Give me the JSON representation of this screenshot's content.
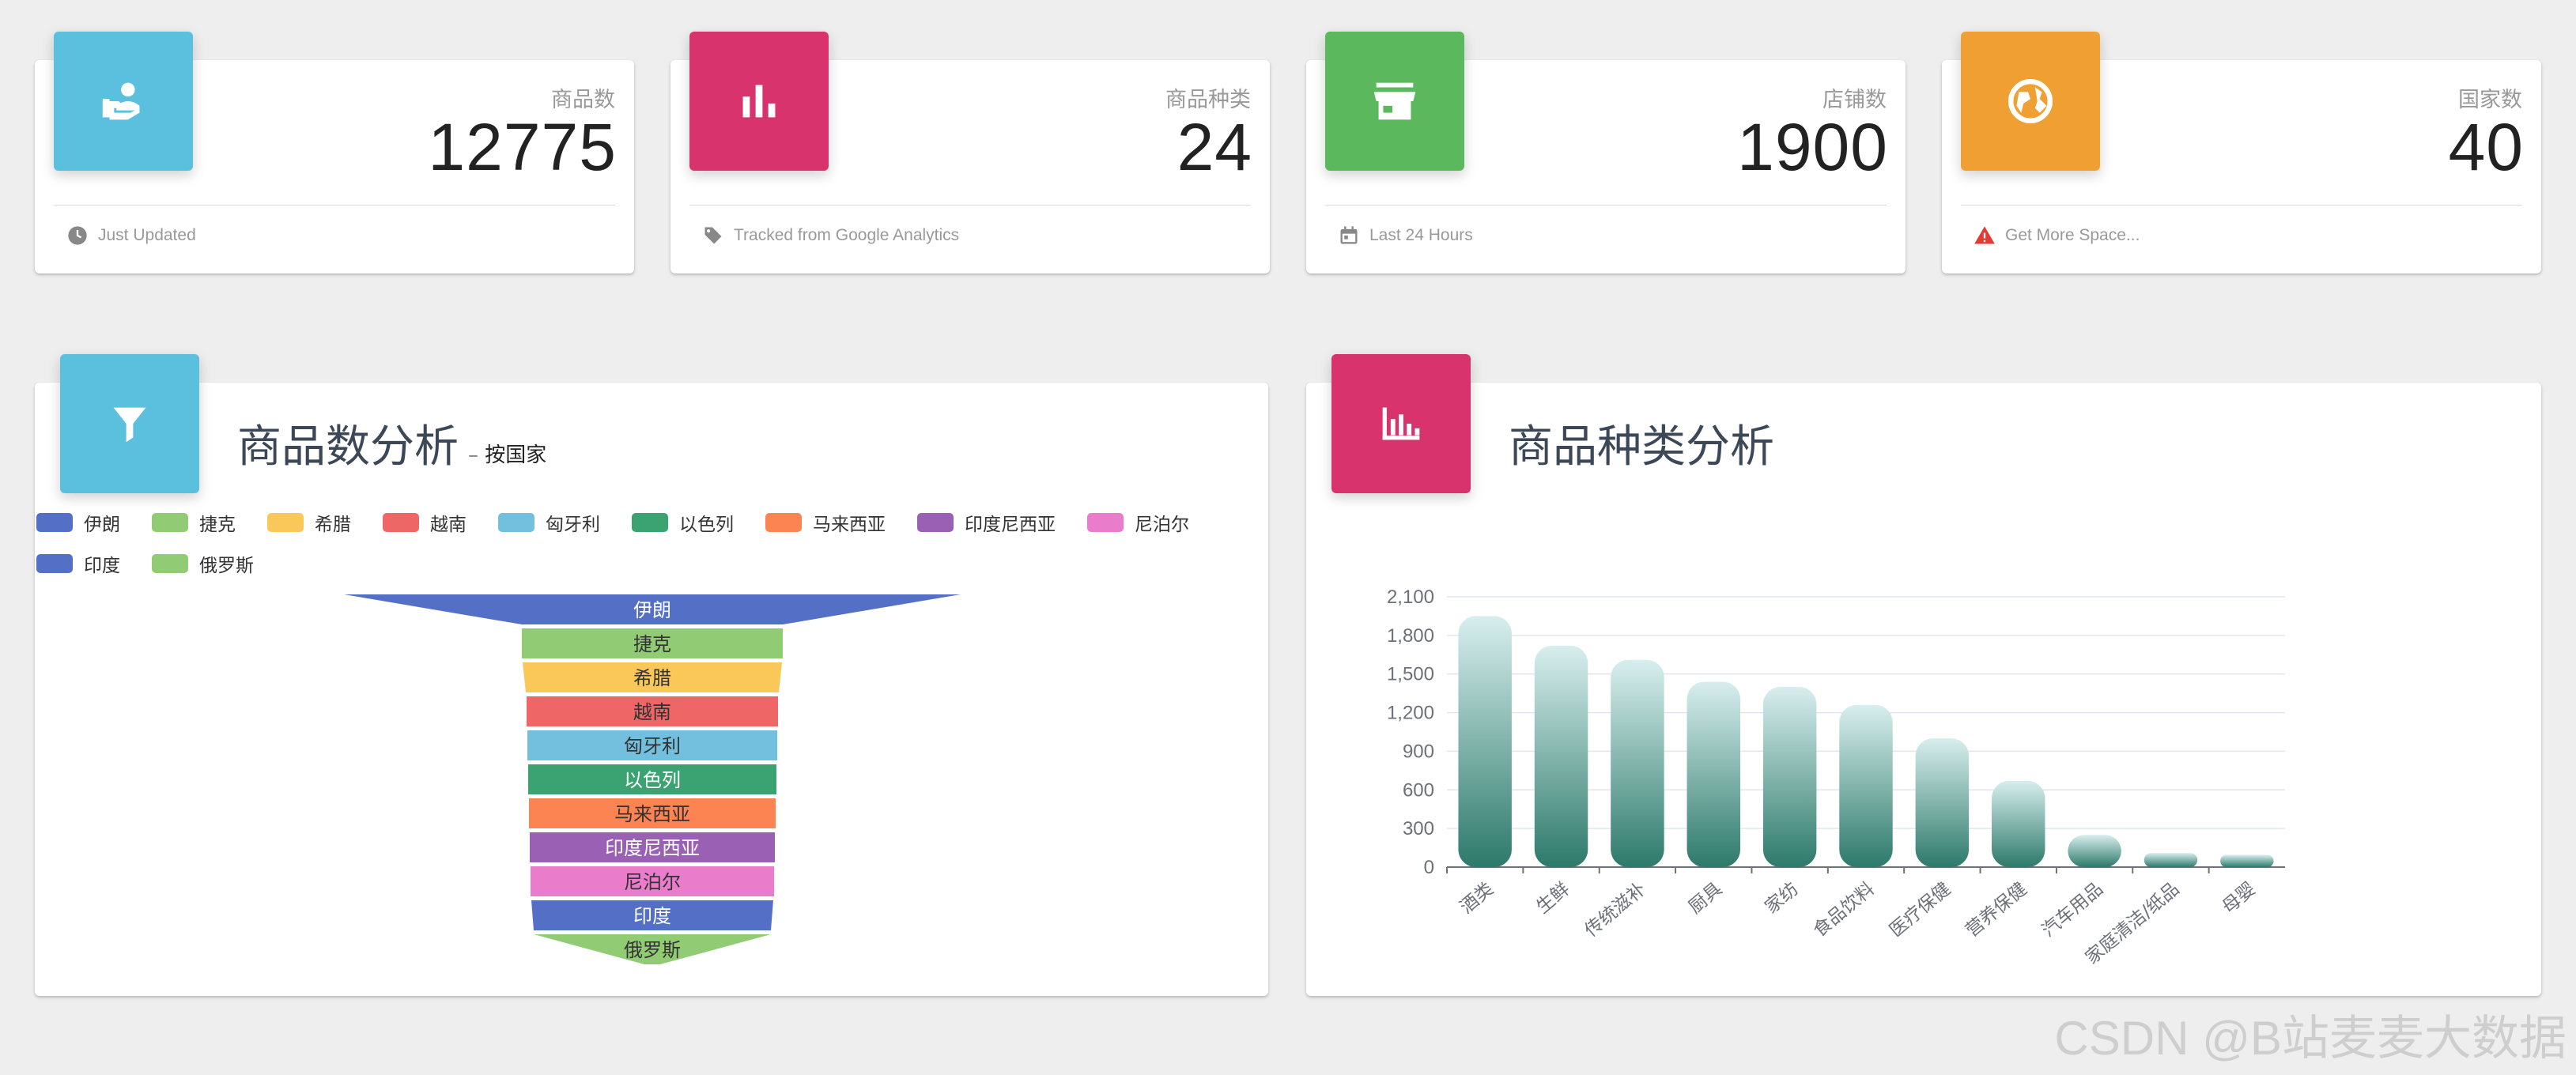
{
  "stats": [
    {
      "label": "商品数",
      "value": "12775",
      "footer": "Just Updated",
      "icon": "user-hand-icon",
      "footer_icon": "clock-icon",
      "color": "#5bc0de"
    },
    {
      "label": "商品种类",
      "value": "24",
      "footer": "Tracked from Google Analytics",
      "icon": "bar-chart-icon",
      "footer_icon": "tag-icon",
      "color": "#d9336e"
    },
    {
      "label": "店铺数",
      "value": "1900",
      "footer": "Last 24 Hours",
      "icon": "store-icon",
      "footer_icon": "calendar-icon",
      "color": "#5cb85c"
    },
    {
      "label": "国家数",
      "value": "40",
      "footer": "Get More Space...",
      "icon": "globe-icon",
      "footer_icon": "warning-icon",
      "color": "#f0a033"
    }
  ],
  "panels": {
    "funnel": {
      "title": "商品数分析",
      "subtitle": "– 按国家",
      "icon": "filter-icon",
      "color": "#5bc0de"
    },
    "bar": {
      "title": "商品种类分析",
      "icon": "bar-chart-dense-icon",
      "color": "#d9336e"
    }
  },
  "watermark": "CSDN @B站麦麦大数据",
  "chart_data": [
    {
      "type": "funnel",
      "categories": [
        "伊朗",
        "捷克",
        "希腊",
        "越南",
        "匈牙利",
        "以色列",
        "马来西亚",
        "印度尼西亚",
        "尼泊尔",
        "印度",
        "俄罗斯"
      ],
      "colors": [
        "#5470c6",
        "#91cc75",
        "#fac858",
        "#ee6666",
        "#73c0de",
        "#3ba272",
        "#fc8452",
        "#9a60b4",
        "#ea7ccc",
        "#5470c6",
        "#91cc75"
      ],
      "legend": "top-left",
      "title": "商品数分析"
    },
    {
      "type": "bar",
      "categories": [
        "酒类",
        "生鲜",
        "传统滋补",
        "厨具",
        "家纺",
        "食品饮料",
        "医疗保健",
        "营养保健",
        "汽车用品",
        "家庭清洁/纸品",
        "母婴"
      ],
      "values": [
        1950,
        1720,
        1610,
        1440,
        1400,
        1260,
        1000,
        670,
        250,
        110,
        95
      ],
      "yticks": [
        "0",
        "300",
        "600",
        "900",
        "1,200",
        "1,500",
        "1,800",
        "2,100"
      ],
      "ylim": [
        0,
        2100
      ],
      "grid": true,
      "colors": {
        "top": "#d8eeee",
        "bottom": "#2d7a6a"
      },
      "title": "商品种类分析"
    }
  ]
}
